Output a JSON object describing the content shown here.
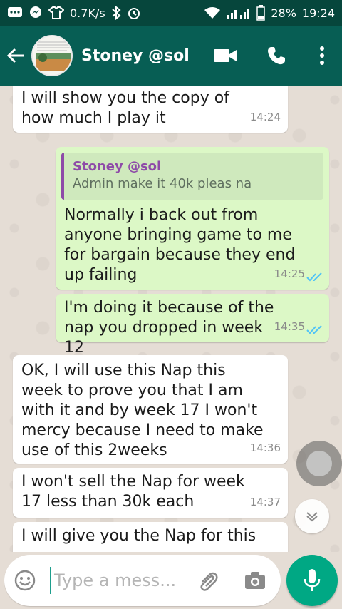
{
  "status_bar": {
    "speed": "0.7K/s",
    "battery": "28%",
    "time": "19:24"
  },
  "header": {
    "title": "Stoney @sol",
    "icons": [
      "back-arrow-icon",
      "video-call-icon",
      "voice-call-icon",
      "more-options-icon"
    ]
  },
  "messages": [
    {
      "dir": "in",
      "text": "I will show you the copy of how much I play it",
      "time": "14:24"
    },
    {
      "dir": "out",
      "quote_name": "Stoney @sol",
      "quote_text": "Admin make it 40k pleas na",
      "text": "Normally i back out from anyone bringing game to me for bargain because they end up failing",
      "time": "14:25",
      "read": true
    },
    {
      "dir": "out",
      "text": "I'm doing it because of the nap you dropped in week 12",
      "time": "14:35",
      "read": true
    },
    {
      "dir": "in",
      "text": "OK, I will use this Nap this week to prove you that I am with it and by week 17 I won't mercy because I need to make use of this 2weeks",
      "time": "14:36"
    },
    {
      "dir": "in",
      "text": "I won't sell the Nap for week 17 less than 30k each",
      "time": "14:37"
    },
    {
      "dir": "in",
      "text": "I will give you the Nap for this",
      "time": ""
    }
  ],
  "composer": {
    "placeholder": "Type a mess..."
  },
  "colors": {
    "header": "#075e54",
    "status_bar": "#06463c",
    "outgoing": "#dcf8c6",
    "incoming": "#ffffff",
    "read_tick": "#4fc3f7",
    "accent": "#00a884"
  }
}
